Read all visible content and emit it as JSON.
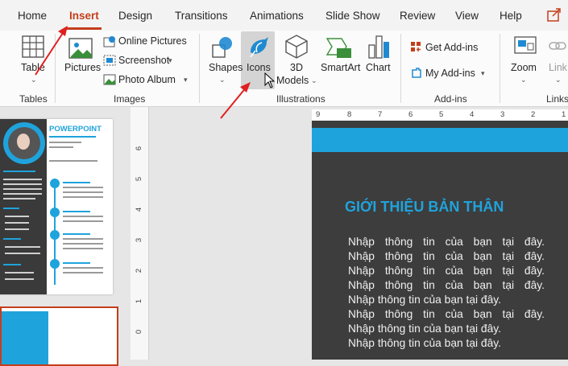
{
  "ribbon_tabs": [
    {
      "label": "Home",
      "active": false
    },
    {
      "label": "Insert",
      "active": true
    },
    {
      "label": "Design",
      "active": false
    },
    {
      "label": "Transitions",
      "active": false
    },
    {
      "label": "Animations",
      "active": false
    },
    {
      "label": "Slide Show",
      "active": false
    },
    {
      "label": "Review",
      "active": false
    },
    {
      "label": "View",
      "active": false
    },
    {
      "label": "Help",
      "active": false
    }
  ],
  "groups": {
    "tables": {
      "label": "Tables",
      "table_button": "Table"
    },
    "images": {
      "label": "Images",
      "pictures_button": "Pictures",
      "online_pictures": "Online Pictures",
      "screenshot": "Screenshot",
      "photo_album": "Photo Album"
    },
    "illustrations": {
      "label": "Illustrations",
      "shapes": "Shapes",
      "icons": "Icons",
      "models_line1": "3D",
      "models_line2": "Models",
      "smartart": "SmartArt",
      "chart": "Chart"
    },
    "addins": {
      "label": "Add-ins",
      "get_addins": "Get Add-ins",
      "my_addins": "My Add-ins"
    },
    "links": {
      "label": "Links",
      "zoom": "Zoom",
      "link": "Link"
    }
  },
  "thumbnail": {
    "title": "POWERPOINT"
  },
  "vertical_ruler": [
    "6",
    "5",
    "4",
    "3",
    "2",
    "1",
    "0"
  ],
  "horizontal_ruler": [
    "9",
    "8",
    "7",
    "6",
    "5",
    "4",
    "3",
    "2",
    "1"
  ],
  "slide": {
    "title": "GIỚI THIỆU BẢN THÂN",
    "lines": [
      "Nhập thông tin của bạn tại đây.",
      "Nhập thông tin của bạn tại đây.",
      "Nhập thông tin của bạn tại đây.",
      "Nhập thông tin của bạn tại đây.",
      "Nhập thông tin của bạn tại đây.",
      "Nhập thông tin của bạn tại đây.",
      "Nhập thông tin của bạn tại đây.",
      "Nhập thông tin của bạn tại đây."
    ]
  },
  "colors": {
    "accent": "#c43e1c",
    "slide_blue": "#1fa3dc",
    "slide_bg": "#3d3d3d"
  }
}
